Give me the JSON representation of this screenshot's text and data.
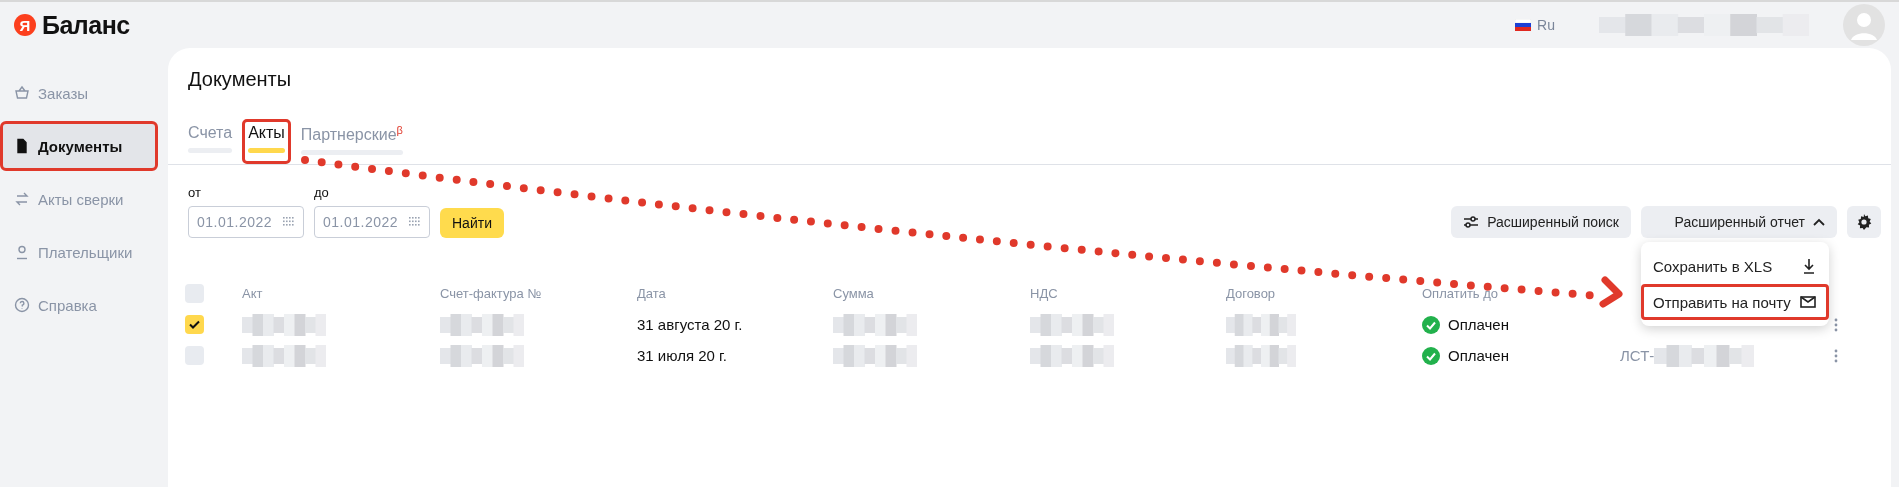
{
  "header": {
    "logo_letter": "Я",
    "logo_text": "Баланс",
    "language": "Ru",
    "user": {
      "kind": "redacted"
    }
  },
  "sidebar": {
    "items": [
      {
        "label": "Заказы",
        "selected": false,
        "highlighted": false
      },
      {
        "label": "Документы",
        "selected": true,
        "highlighted": true
      },
      {
        "label": "Акты сверки",
        "selected": false,
        "highlighted": false
      },
      {
        "label": "Плательщики",
        "selected": false,
        "highlighted": false
      },
      {
        "label": "Справка",
        "selected": false,
        "highlighted": false
      }
    ]
  },
  "page": {
    "title": "Документы",
    "tabs": [
      {
        "label": "Счета",
        "selected": false,
        "highlighted": false
      },
      {
        "label": "Акты",
        "selected": true,
        "highlighted": true
      },
      {
        "label": "Партнерские",
        "sup": "β",
        "selected": false,
        "highlighted": false
      }
    ],
    "filters": {
      "from": {
        "label": "от",
        "value": "01.01.2022"
      },
      "to": {
        "label": "до",
        "value": "01.01.2022"
      },
      "submit": "Найти"
    },
    "actions": {
      "search": "Расширенный поиск",
      "report": {
        "label": "Расширенный отчет",
        "expanded": true,
        "menu": [
          {
            "label": "Сохранить в XLS",
            "highlighted": false
          },
          {
            "label": "Отправить на почту",
            "highlighted": true
          }
        ]
      }
    },
    "table": {
      "select_all": {
        "checked": false
      },
      "columns": [
        "Акт",
        "Счет-фактура №",
        "Дата",
        "Сумма",
        "НДС",
        "Договор",
        "Оплатить до"
      ],
      "rows": [
        {
          "checked": true,
          "cells": [
            {
              "kind": "redacted"
            },
            {
              "kind": "redacted"
            },
            {
              "kind": "text",
              "text": "31 августа 20 г."
            },
            {
              "kind": "redacted"
            },
            {
              "kind": "redacted"
            },
            {
              "kind": "redacted"
            },
            {
              "kind": "status",
              "text": "Оплачен"
            }
          ]
        },
        {
          "checked": false,
          "cells": [
            {
              "kind": "redacted"
            },
            {
              "kind": "redacted"
            },
            {
              "kind": "text",
              "text": "31 июля 20 г."
            },
            {
              "kind": "redacted"
            },
            {
              "kind": "redacted"
            },
            {
              "kind": "redacted"
            },
            {
              "kind": "status",
              "text": "Оплачен"
            },
            {
              "kind": "prefix_redacted",
              "text": "ЛСТ-"
            }
          ]
        }
      ]
    }
  },
  "annotation": {
    "kind": "dotted-arrow"
  }
}
